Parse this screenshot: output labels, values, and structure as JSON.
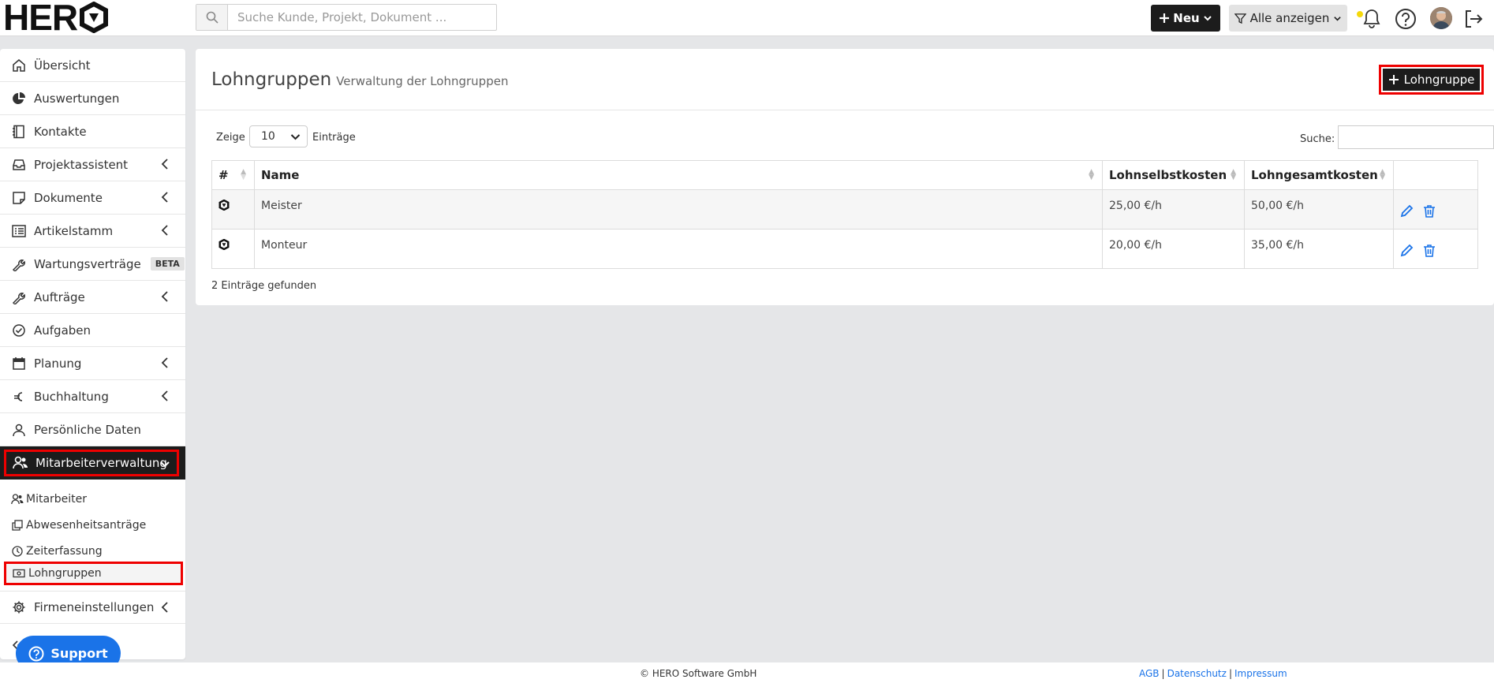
{
  "header": {
    "logo": "HER",
    "search_placeholder": "Suche Kunde, Projekt, Dokument ...",
    "new_button": "Neu",
    "filter_button": "Alle anzeigen"
  },
  "sidebar": {
    "items": [
      {
        "label": "Übersicht",
        "icon": "home-icon"
      },
      {
        "label": "Auswertungen",
        "icon": "pie-chart-icon"
      },
      {
        "label": "Kontakte",
        "icon": "address-book-icon"
      },
      {
        "label": "Projektassistent",
        "icon": "inbox-icon"
      },
      {
        "label": "Dokumente",
        "icon": "sticky-note-icon"
      },
      {
        "label": "Artikelstamm",
        "icon": "list-icon"
      },
      {
        "label": "Wartungsverträge",
        "icon": "wrench-icon",
        "badge": "BETA"
      },
      {
        "label": "Aufträge",
        "icon": "wrench-icon"
      },
      {
        "label": "Aufgaben",
        "icon": "check-circle-icon"
      },
      {
        "label": "Planung",
        "icon": "calendar-icon"
      },
      {
        "label": "Buchhaltung",
        "icon": "euro-icon"
      },
      {
        "label": "Persönliche Daten",
        "icon": "user-icon"
      }
    ],
    "active_item": "Mitarbeiterverwaltung",
    "sub_items": [
      "Mitarbeiter",
      "Abwesenheitsanträge",
      "Zeiterfassung"
    ],
    "selected_sub_item": "Lohngruppen",
    "after_item": "Firmeneinstellungen",
    "support_button": "Support"
  },
  "main": {
    "title": "Lohngruppen",
    "subtitle": "Verwaltung der Lohngruppen",
    "add_button": "Lohngruppe",
    "length_label_before": "Zeige",
    "length_value": "10",
    "length_label_after": "Einträge",
    "search_label": "Suche:",
    "table": {
      "headers": [
        "#",
        "Name",
        "Lohnselbstkosten",
        "Lohngesamtkosten",
        ""
      ],
      "rows": [
        {
          "name": "Meister",
          "selbstkosten": "25,00 €/h",
          "gesamtkosten": "50,00 €/h"
        },
        {
          "name": "Monteur",
          "selbstkosten": "20,00 €/h",
          "gesamtkosten": "35,00 €/h"
        }
      ]
    },
    "entries_found": "2 Einträge gefunden"
  },
  "footer": {
    "copyright": "© HERO Software GmbH",
    "links": [
      "AGB",
      "Datenschutz",
      "Impressum"
    ]
  }
}
